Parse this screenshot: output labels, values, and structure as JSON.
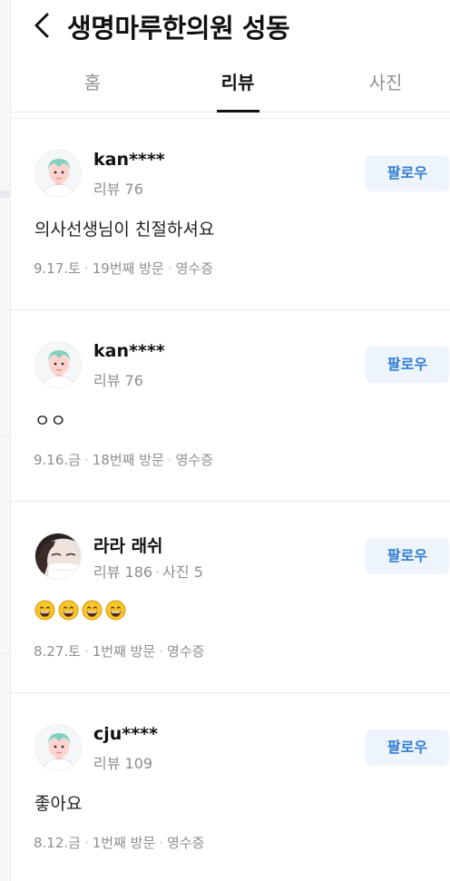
{
  "header": {
    "title": "생명마루한의원 성동"
  },
  "tabs": [
    {
      "label": "홈",
      "active": false
    },
    {
      "label": "리뷰",
      "active": true
    },
    {
      "label": "사진",
      "active": false
    }
  ],
  "follow_label": "팔로우",
  "reviews": [
    {
      "nickname": "kan****",
      "review_count": "리뷰 76",
      "photo_count": "",
      "text": "의사선생님이 친절하셔요",
      "date": "9.17.토",
      "visit": "19번째 방문",
      "receipt": "영수증",
      "avatar": "default-avatar-icon"
    },
    {
      "nickname": "kan****",
      "review_count": "리뷰 76",
      "photo_count": "",
      "text": "ㅇㅇ",
      "date": "9.16.금",
      "visit": "18번째 방문",
      "receipt": "영수증",
      "avatar": "default-avatar-icon"
    },
    {
      "nickname": "라라 래쉬",
      "review_count": "리뷰 186",
      "photo_count": "사진 5",
      "text": "",
      "emoji_count": 4,
      "emoji": "grinning-face-icon",
      "date": "8.27.토",
      "visit": "1번째 방문",
      "receipt": "영수증",
      "avatar": "profile-photo"
    },
    {
      "nickname": "cju****",
      "review_count": "리뷰 109",
      "photo_count": "",
      "text": "좋아요",
      "date": "8.12.금",
      "visit": "1번째 방문",
      "receipt": "영수증",
      "avatar": "default-avatar-icon"
    }
  ],
  "colors": {
    "follow_bg": "#edf4fc",
    "follow_text": "#2f7dd3",
    "muted_text": "#8b8e93"
  }
}
